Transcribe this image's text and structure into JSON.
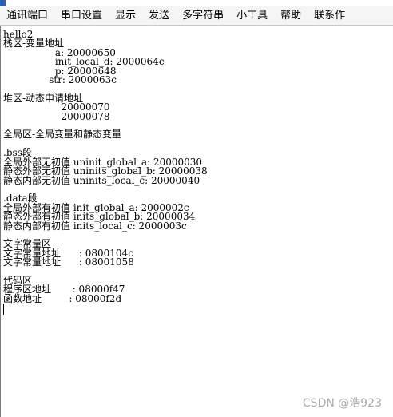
{
  "menubar": {
    "items": [
      "通讯端口",
      "串口设置",
      "显示",
      "发送",
      "多字符串",
      "小工具",
      "帮助",
      "联系作"
    ]
  },
  "terminal": {
    "lines": [
      "hello2",
      "栈区-变量地址",
      "                 a: 20000650",
      "                 init_local_d: 2000064c",
      "                 p: 20000648",
      "               str: 2000063c",
      "",
      "堆区-动态申请地址",
      "                   20000070",
      "                   20000078",
      "",
      "全局区-全局变量和静态变量",
      "",
      ".bss段",
      "全局外部无初值 uninit_global_a: 20000030",
      "静态外部无初值 uninits_global_b: 20000038",
      "静态内部无初值 uninits_local_c: 20000040",
      "",
      ".data段",
      "全局外部有初值 init_global_a: 2000002c",
      "静态外部有初值 inits_global_b: 20000034",
      "静态内部有初值 inits_local_c: 2000003c",
      "",
      "文字常量区",
      "文字常量地址      : 0800104c",
      "文字常量地址      : 08001058",
      "",
      "代码区",
      "程序区地址       : 08000f47",
      "函数地址         : 08000f2d"
    ]
  },
  "watermark": "CSDN @浩923"
}
